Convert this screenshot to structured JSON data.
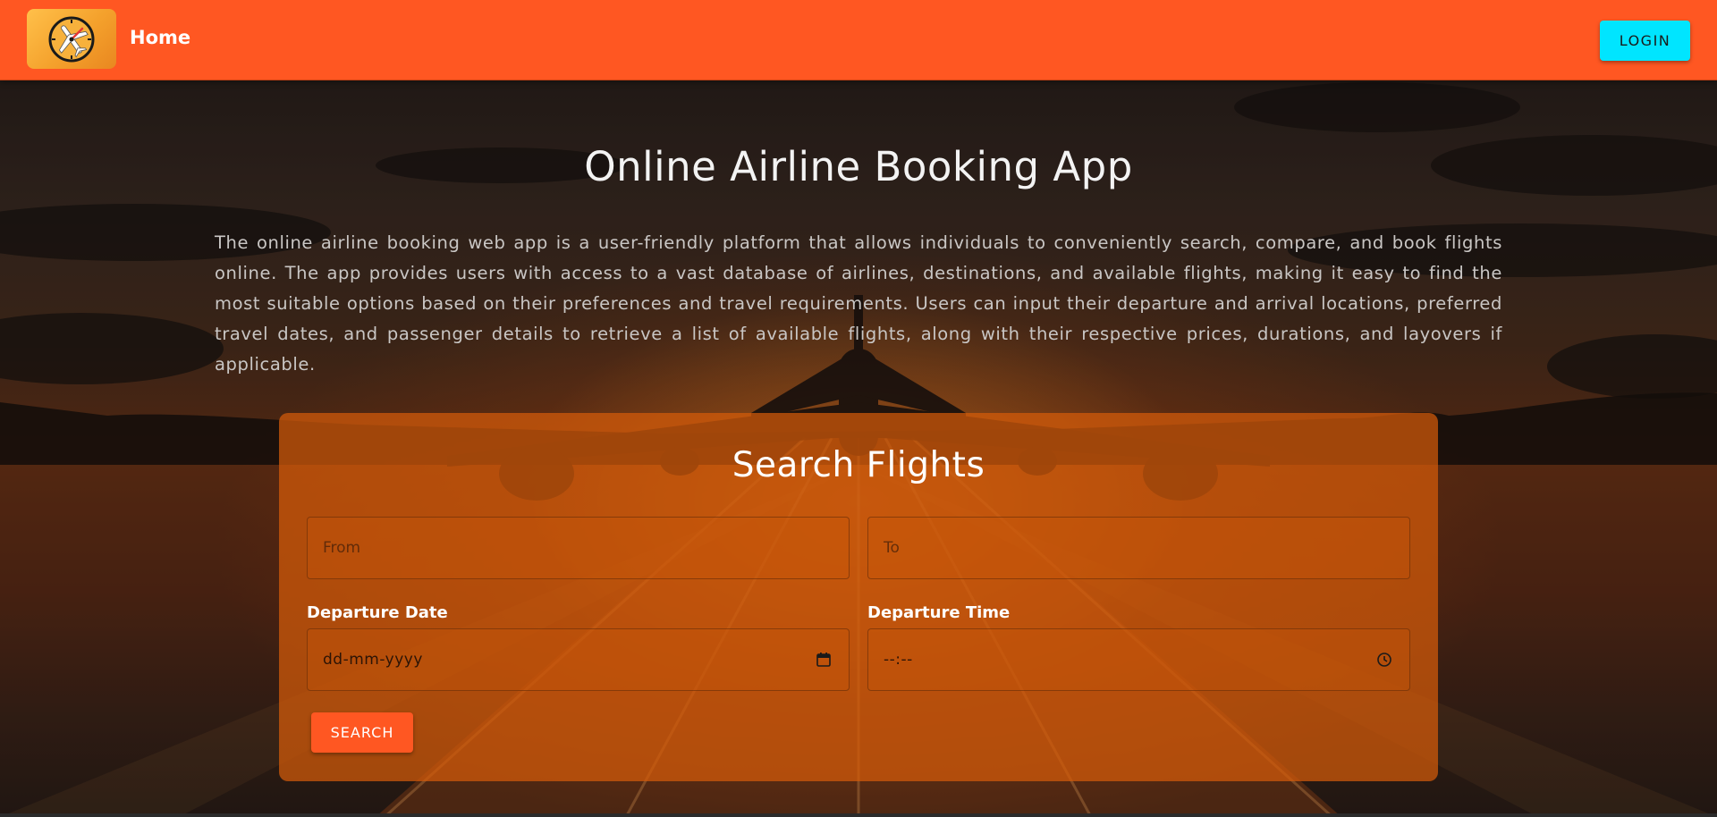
{
  "navbar": {
    "logo_icon": "clock-plane-logo-icon",
    "home_label": "Home",
    "login_label": "LOGIN",
    "background_color": "#ff5722",
    "login_color": "#00e5ff"
  },
  "hero": {
    "title": "Online Airline Booking App",
    "description": "The online airline booking web app is a user-friendly platform that allows individuals to conveniently search, compare, and book flights online. The app provides users with access to a vast database of airlines, destinations, and available flights, making it easy to find the most suitable options based on their preferences and travel requirements. Users can input their departure and arrival locations, preferred travel dates, and passenger details to retrieve a list of available flights, along with their respective prices, durations, and layovers if applicable."
  },
  "search": {
    "title": "Search Flights",
    "from_placeholder": "From",
    "to_placeholder": "To",
    "departure_date_label": "Departure Date",
    "departure_date_value": "dd-mm-yyyy",
    "departure_date_icon": "calendar-icon",
    "departure_time_label": "Departure Time",
    "departure_time_value": "--:--",
    "departure_time_icon": "clock-icon",
    "button_label": "SEARCH",
    "card_color": "#d65c0a",
    "button_color": "#ff5722"
  }
}
